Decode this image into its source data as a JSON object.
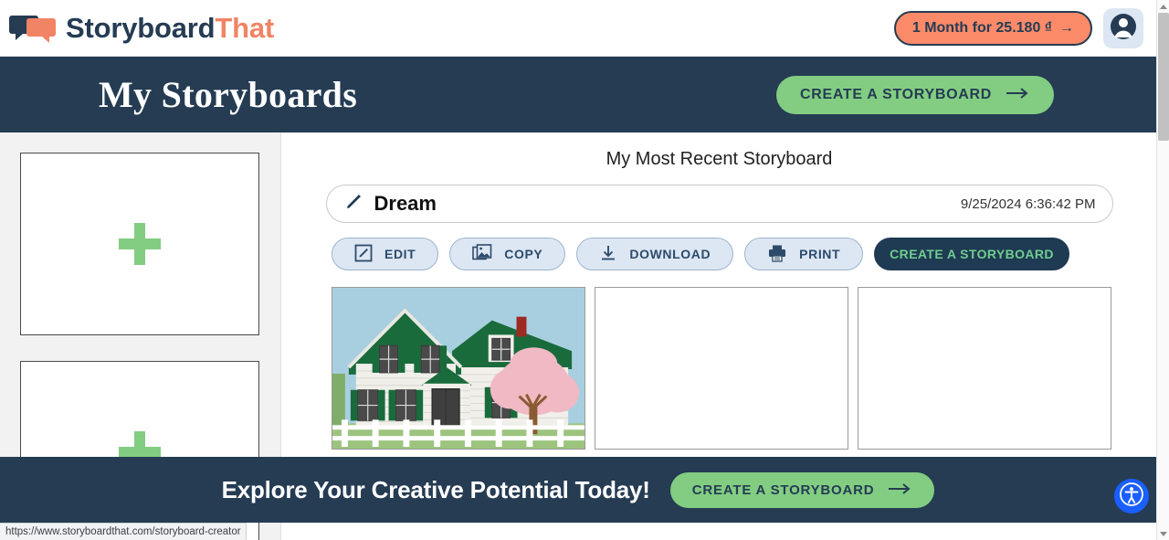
{
  "browser": {
    "status_url": "https://www.storyboardthat.com/storyboard-creator",
    "scrollbar": {
      "up_arrow": "▲",
      "down_arrow": "▼"
    }
  },
  "topbar": {
    "logo": {
      "name_part1": "Storyboard",
      "name_part2": "That",
      "icon": "speech-bubbles-icon"
    },
    "promo_button": {
      "label": "1 Month for 25.180 ₫",
      "arrow": "→",
      "bg": "#fb8a69",
      "text_color": "#253c53"
    },
    "avatar": {
      "icon": "user-avatar-icon"
    }
  },
  "pageheader": {
    "title": "My Storyboards",
    "cta": {
      "label": "CREATE A STORYBOARD",
      "arrow": "→",
      "bg": "#82cd82",
      "text_color": "#253c53"
    },
    "bg": "#253c53"
  },
  "sidebar": {
    "cards": [
      {
        "icon": "plus-icon",
        "label": ""
      },
      {
        "icon": "plus-icon",
        "label": ""
      }
    ],
    "bg": "#f2f2f2",
    "plus_color": "#82cd82"
  },
  "main": {
    "section_title": "My Most Recent Storyboard",
    "storyboard": {
      "edit_icon": "pencil-icon",
      "name": "Dream",
      "timestamp": "9/25/2024 6:36:42 PM"
    },
    "actions": [
      {
        "label": "EDIT",
        "icon": "pencil-square-icon",
        "style": "light"
      },
      {
        "label": "COPY",
        "icon": "image-copy-icon",
        "style": "light"
      },
      {
        "label": "DOWNLOAD",
        "icon": "download-icon",
        "style": "light"
      },
      {
        "label": "PRINT",
        "icon": "printer-icon",
        "style": "light"
      },
      {
        "label": "CREATE A STORYBOARD",
        "icon": "",
        "style": "dark"
      }
    ],
    "cells": [
      {
        "type": "illustration",
        "description": "white house with green roof, green shutters, cherry blossom tree and picket fence"
      },
      {
        "type": "empty",
        "description": ""
      },
      {
        "type": "empty",
        "description": ""
      }
    ],
    "colors": {
      "action_light_bg": "#dce7f3",
      "action_light_text": "#2d4a6b",
      "action_dark_bg": "#1f3a53",
      "action_dark_text": "#6fce8f"
    }
  },
  "promobar": {
    "text": "Explore Your Creative Potential Today!",
    "cta": {
      "label": "CREATE A STORYBOARD",
      "arrow": "→"
    },
    "bg": "#253c53"
  },
  "accessibility": {
    "icon": "accessibility-icon",
    "color": "#1a5fff"
  }
}
